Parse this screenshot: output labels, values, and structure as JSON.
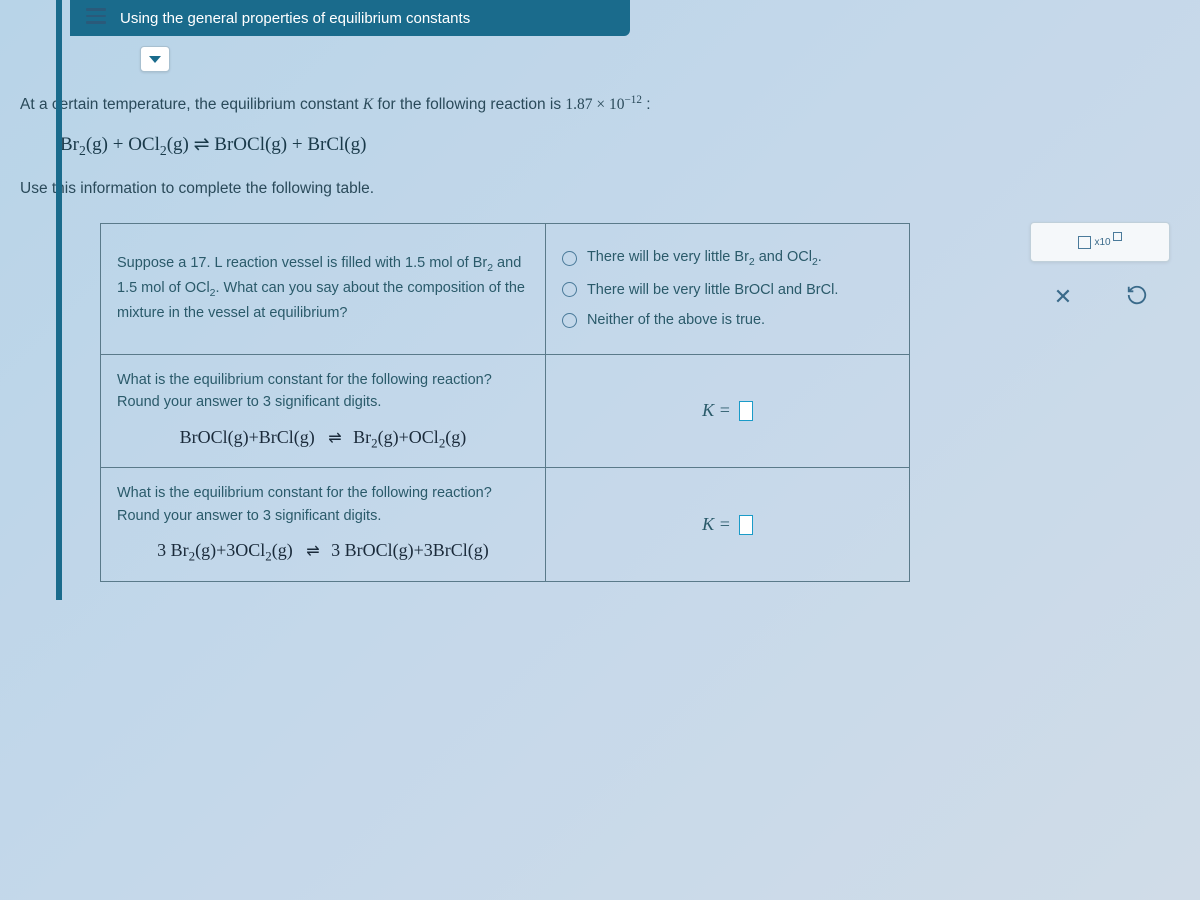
{
  "header": {
    "title": "Using the general properties of equilibrium constants"
  },
  "problem": {
    "intro_a": "At a certain temperature, the equilibrium constant ",
    "intro_k": "K",
    "intro_b": " for the following reaction is ",
    "k_value": "1.87 × 10",
    "k_exp": "−12",
    "intro_c": " :",
    "equation": "Br₂(g) + OCl₂(g) ⇌ BrOCl(g) + BrCl(g)",
    "instruction": "Use this information to complete the following table."
  },
  "table": {
    "row1": {
      "prompt_a": "Suppose a 17. L reaction vessel is filled with 1.5 mol of Br",
      "prompt_b": " and 1.5 mol of OCl",
      "prompt_c": ". What can you say about the composition of the mixture in the vessel at equilibrium?",
      "opt1_a": "There will be very little Br",
      "opt1_b": " and OCl",
      "opt1_c": ".",
      "opt2": "There will be very little BrOCl and BrCl.",
      "opt3": "Neither of the above is true."
    },
    "row2": {
      "prompt": "What is the equilibrium constant for the following reaction? Round your answer to 3 significant digits.",
      "equation": "BrOCl(g) + BrCl(g)   ⇌   Br₂(g) + OCl₂(g)",
      "answer_label": "K ="
    },
    "row3": {
      "prompt": "What is the equilibrium constant for the following reaction? Round your answer to 3 significant digits.",
      "equation": "3 Br₂(g) + 3 OCl₂(g)   ⇌   3 BrOCl(g) + 3 BrCl(g)",
      "answer_label": "K ="
    }
  },
  "tools": {
    "sci_label": "x10"
  }
}
